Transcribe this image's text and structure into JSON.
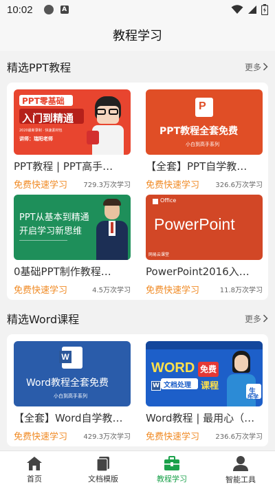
{
  "status": {
    "time": "10:02",
    "a_badge": "A"
  },
  "appbar": {
    "title": "教程学习"
  },
  "sections": [
    {
      "title": "精选PPT教程",
      "more": "更多",
      "items": [
        {
          "name": "PPT教程 | PPT高手…",
          "free": "免费快速学习",
          "count": "729.3万次学习",
          "thumb_lines": [
            "PPT零基础",
            "入门到精通",
            "2020最新录制 · 快速素材包",
            "讲师：瑞阳老师"
          ]
        },
        {
          "name": "【全套】PPT自学教…",
          "free": "免费快速学习",
          "count": "326.6万次学习",
          "thumb_lines": [
            "PPT教程全套免费",
            "小白到高手系列"
          ]
        },
        {
          "name": "0基础PPT制作教程…",
          "free": "免费快速学习",
          "count": "4.5万次学习",
          "thumb_lines": [
            "PPT从基本到精通",
            "开启学习新思维"
          ]
        },
        {
          "name": "PowerPoint2016入…",
          "free": "免费快速学习",
          "count": "11.8万次学习",
          "thumb_lines": [
            "Office",
            "PowerPoint",
            "网易云课堂"
          ]
        }
      ]
    },
    {
      "title": "精选Word课程",
      "more": "更多",
      "items": [
        {
          "name": "【全套】Word自学教…",
          "free": "免费快速学习",
          "count": "429.3万次学习",
          "thumb_lines": [
            "Word教程全套免费",
            "小白到高手系列"
          ]
        },
        {
          "name": "Word教程 | 最用心（…",
          "free": "免费快速学习",
          "count": "236.6万次学习",
          "thumb_lines": [
            "WORD",
            "免费",
            "文档处理",
            "课程",
            "生",
            "所学"
          ]
        }
      ]
    }
  ],
  "tabs": [
    {
      "label": "首页",
      "icon": "home-icon"
    },
    {
      "label": "文档模版",
      "icon": "document-icon"
    },
    {
      "label": "教程学习",
      "icon": "toolbox-icon",
      "active": true
    },
    {
      "label": "智能工具",
      "icon": "user-icon"
    }
  ],
  "colors": {
    "accent_green": "#1aa14a",
    "free_orange": "#f08a24"
  }
}
